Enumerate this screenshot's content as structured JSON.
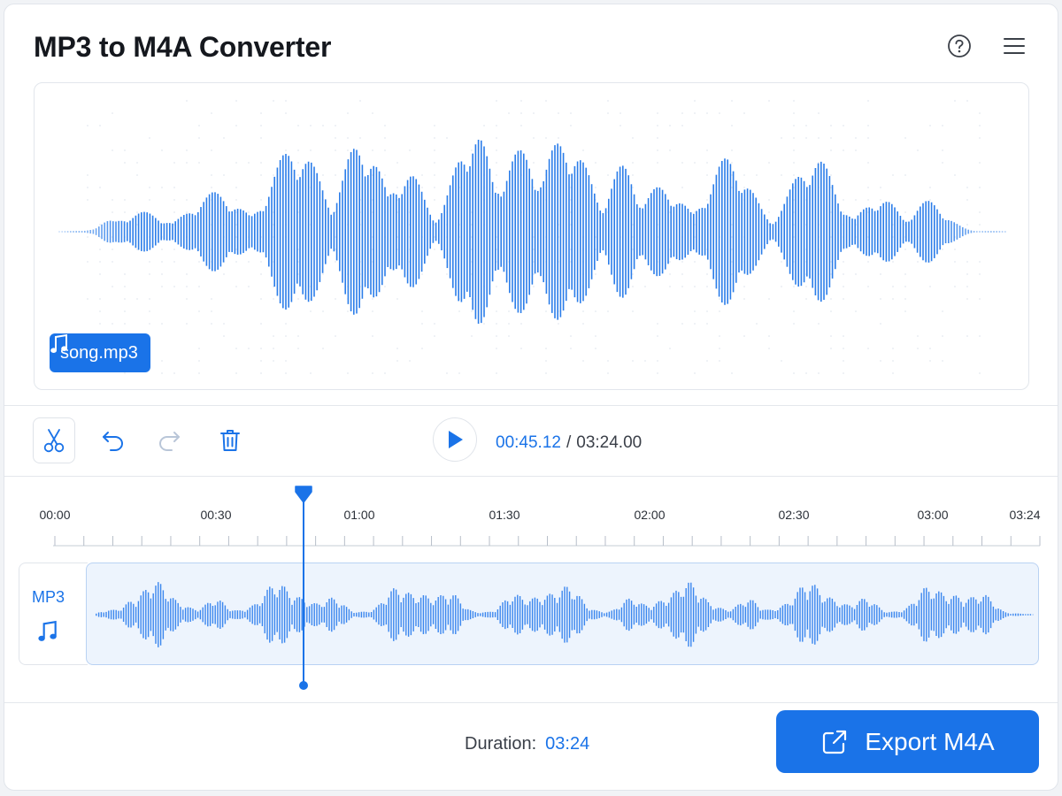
{
  "app": {
    "title": "MP3 to M4A Converter",
    "accent": "#1a73e8"
  },
  "header": {
    "help_icon": "help-circle-icon",
    "menu_icon": "hamburger-menu-icon"
  },
  "preview": {
    "file_name": "song.mp3",
    "file_icon": "music-note-icon"
  },
  "toolbar": {
    "tools": [
      "scissors-icon",
      "undo-icon",
      "redo-icon",
      "trash-icon"
    ],
    "play_icon": "play-icon",
    "current_time": "00:45.12",
    "separator": "/",
    "total_time": "03:24.00"
  },
  "timeline": {
    "ticks": [
      "00:00",
      "00:30",
      "01:00",
      "01:30",
      "02:00",
      "02:30",
      "03:00",
      "03:24"
    ],
    "playhead_fraction": 0.2212
  },
  "track": {
    "label": "MP3",
    "icon": "music-note-icon"
  },
  "footer": {
    "duration_label": "Duration:",
    "duration_value": "03:24",
    "export_label": "Export M4A",
    "export_icon": "external-link-icon"
  }
}
